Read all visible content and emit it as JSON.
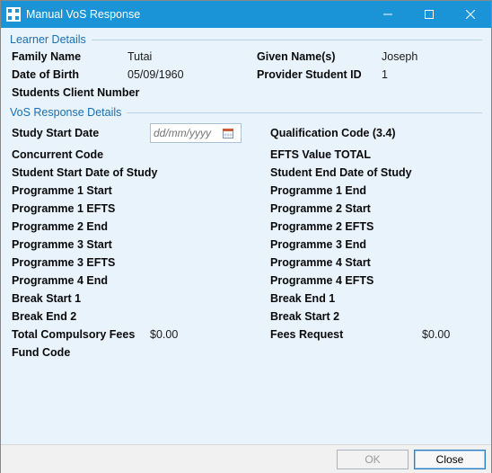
{
  "window": {
    "title": "Manual VoS Response"
  },
  "learner": {
    "header": "Learner Details",
    "familyName": {
      "label": "Family Name",
      "value": "Tutai"
    },
    "givenNames": {
      "label": "Given Name(s)",
      "value": "Joseph"
    },
    "dob": {
      "label": "Date of Birth",
      "value": "05/09/1960"
    },
    "providerId": {
      "label": "Provider Student ID",
      "value": "1"
    },
    "clientNumber": {
      "label": "Students Client Number",
      "value": ""
    }
  },
  "vos": {
    "header": "VoS Response Details",
    "studyStart": {
      "label": "Study Start Date",
      "placeholder": "dd/mm/yyyy"
    },
    "qualCode": {
      "label": "Qualification Code (3.4)",
      "value": ""
    },
    "concurrent": {
      "label": "Concurrent Code",
      "value": ""
    },
    "efts": {
      "label": "EFTS Value TOTAL",
      "value": ""
    },
    "stuStart": {
      "label": "Student Start Date of Study",
      "value": ""
    },
    "stuEnd": {
      "label": "Student End Date of Study",
      "value": ""
    },
    "p1start": {
      "label": "Programme 1 Start",
      "value": ""
    },
    "p1end": {
      "label": "Programme 1 End",
      "value": ""
    },
    "p1efts": {
      "label": "Programme 1 EFTS",
      "value": ""
    },
    "p2start": {
      "label": "Programme 2 Start",
      "value": ""
    },
    "p2end": {
      "label": "Programme 2 End",
      "value": ""
    },
    "p2efts": {
      "label": "Programme 2 EFTS",
      "value": ""
    },
    "p3start": {
      "label": "Programme 3 Start",
      "value": ""
    },
    "p3end": {
      "label": "Programme 3 End",
      "value": ""
    },
    "p3efts": {
      "label": "Programme 3 EFTS",
      "value": ""
    },
    "p4start": {
      "label": "Programme 4 Start",
      "value": ""
    },
    "p4end": {
      "label": "Programme 4 End",
      "value": ""
    },
    "p4efts": {
      "label": "Programme 4 EFTS",
      "value": ""
    },
    "bs1": {
      "label": "Break Start 1",
      "value": ""
    },
    "be1": {
      "label": "Break End 1",
      "value": ""
    },
    "be2": {
      "label": "Break End 2",
      "value": ""
    },
    "bs2": {
      "label": "Break Start 2",
      "value": ""
    },
    "totalFees": {
      "label": "Total Compulsory Fees",
      "value": "$0.00"
    },
    "feesReq": {
      "label": "Fees Request",
      "value": "$0.00"
    },
    "fundCode": {
      "label": "Fund Code",
      "value": ""
    }
  },
  "buttons": {
    "ok": "OK",
    "close": "Close"
  }
}
